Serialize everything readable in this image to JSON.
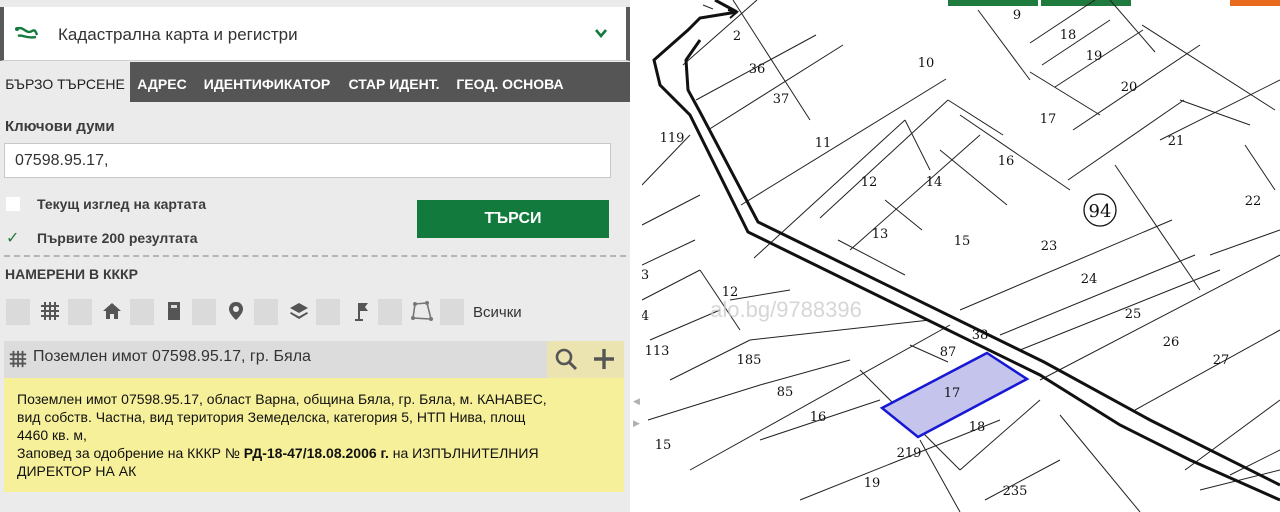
{
  "app": {
    "title": "Кадастрална карта и регистри",
    "logo_icon": "route-icon",
    "collapse_icon": "chevron-down-icon",
    "accent_color": "#137a3e",
    "header_dark": "#555555"
  },
  "tabs": [
    {
      "label": "БЪРЗО ТЪРСЕНЕ",
      "active": true
    },
    {
      "label": "АДРЕС",
      "active": false
    },
    {
      "label": "ИДЕНТИФИКАТОР",
      "active": false
    },
    {
      "label": "СТАР ИДЕНТ.",
      "active": false
    },
    {
      "label": "ГЕОД. ОСНОВА",
      "active": false
    }
  ],
  "search": {
    "keywords_label": "Ключови думи",
    "keywords_value": "07598.95.17,",
    "current_view_label": "Текущ изглед на картата",
    "current_view_checked": false,
    "first200_label": "Първите 200 резултата",
    "first200_checked": true,
    "button_label": "ТЪРСИ"
  },
  "results": {
    "heading": "НАМЕРЕНИ В КККР",
    "filters": [
      "grid-icon",
      "home-icon",
      "building-icon",
      "pin-icon",
      "layers-icon",
      "flag-icon",
      "polygon-icon"
    ],
    "all_label": "Всички",
    "item_title": "Поземлен имот 07598.95.17, гр. Бяла",
    "info_line1": "Поземлен имот 07598.95.17, област Варна, община Бяла, гр. Бяла, м. КАНАВЕС,",
    "info_line2": "вид собств. Частна, вид територия Земеделска, категория 5, НТП Нива, площ",
    "info_line3": "4460 кв. м,",
    "order_prefix": "Заповед за одобрение на КККР №",
    "order_number": "РД-18-47/18.08.2006 г.",
    "order_suffix": "на ИЗПЪЛНИТЕЛНИЯ",
    "order_line2": "ДИРЕКТОР НА АК"
  },
  "map": {
    "watermark": "alo.bg/9788396",
    "block_number": "94",
    "selected_parcel": "17",
    "highlight_color": "#b8b8e6",
    "parcel_labels": [
      "9",
      "2",
      "36",
      "37",
      "10",
      "18",
      "19",
      "20",
      "17",
      "21",
      "11",
      "119",
      "16",
      "12",
      "14",
      "13",
      "15",
      "23",
      "22",
      "24",
      "25",
      "26",
      "27",
      "12",
      "38",
      "87",
      "185",
      "17",
      "85",
      "16",
      "18",
      "113",
      "15",
      "219",
      "19",
      "235",
      "3",
      "4"
    ]
  }
}
